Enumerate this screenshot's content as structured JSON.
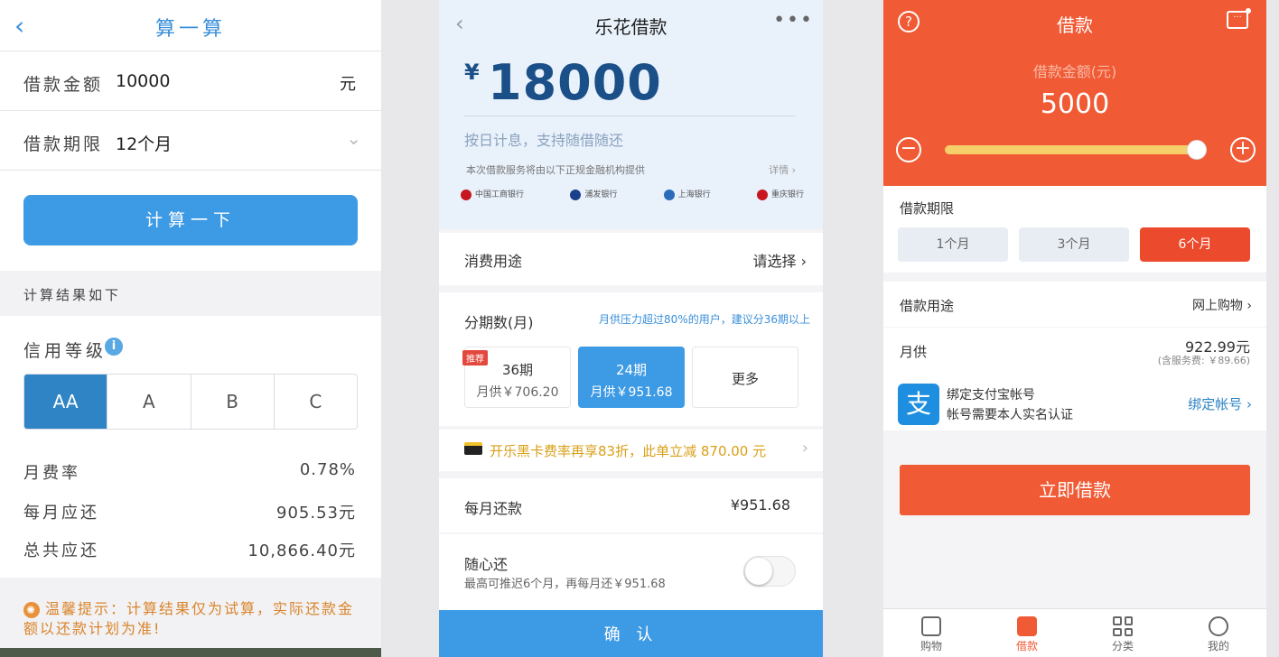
{
  "panel1": {
    "title": "算一算",
    "back_icon": "‹",
    "amount_label": "借款金额",
    "amount_value": "10000",
    "amount_unit": "元",
    "term_label": "借款期限",
    "term_value": "12个月",
    "calc_button": "计算一下",
    "result_header": "计算结果如下",
    "credit_label": "信用等级",
    "grades": [
      "AA",
      "A",
      "B",
      "C"
    ],
    "rate_label": "月费率",
    "rate_value": "0.78%",
    "monthly_label": "每月应还",
    "monthly_value": "905.53元",
    "total_label": "总共应还",
    "total_value": "10,866.40元",
    "tip": "温馨提示：计算结果仅为试算，实际还款金额以还款计划为准!"
  },
  "panel2": {
    "title": "乐花借款",
    "currency": "¥",
    "amount": "18000",
    "subtitle": "按日计息，支持随借随还",
    "service_note": "本次借款服务将由以下正规金融机构提供",
    "detail_link": "详情 ›",
    "banks": [
      {
        "name": "中国工商银行",
        "color": "#c7161e"
      },
      {
        "name": "浦发银行",
        "color": "#1b3f8b"
      },
      {
        "name": "上海银行",
        "color": "#2b6cb8"
      },
      {
        "name": "重庆银行",
        "color": "#c7161e"
      }
    ],
    "purpose_label": "消费用途",
    "purpose_value": "请选择 ›",
    "terms_label": "分期数(月)",
    "terms_hint": "月供压力超过80%的用户，建议分36期以上",
    "badge": "推荐",
    "term_options": [
      {
        "title": "36期",
        "sub": "月供￥706.20"
      },
      {
        "title": "24期",
        "sub": "月供￥951.68"
      },
      {
        "title": "更多",
        "sub": ""
      }
    ],
    "promo": "开乐黑卡费率再享83折，此单立减 870.00 元",
    "monthly_label": "每月还款",
    "monthly_value": "¥951.68",
    "flex_label": "随心还",
    "flex_sub": "最高可推迟6个月，再每月还￥951.68",
    "confirm": "确 认"
  },
  "panel3": {
    "title": "借款",
    "help_icon": "?",
    "amount_label": "借款金额(元)",
    "amount": "5000",
    "slider_fraction": 0.97,
    "term_label": "借款期限",
    "term_options": [
      "1个月",
      "3个月",
      "6个月"
    ],
    "purpose_label": "借款用途",
    "purpose_value": "网上购物 ›",
    "monthly_label": "月供",
    "monthly_value": "922.99元",
    "monthly_fee": "(含服务费: ￥89.66)",
    "alipay_line1": "绑定支付宝帐号",
    "alipay_line2": "帐号需要本人实名认证",
    "alipay_action": "绑定帐号 ›",
    "borrow_button": "立即借款",
    "tabs": [
      "购物",
      "借款",
      "分类",
      "我的"
    ]
  }
}
